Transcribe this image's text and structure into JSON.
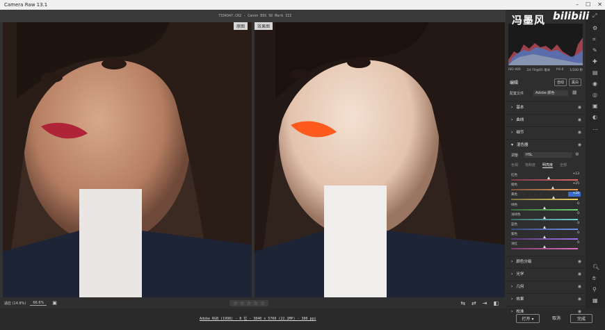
{
  "window": {
    "title": "Camera Raw 13.1"
  },
  "file": {
    "info": "7334347.CR2  -  Canon EOS 5D Mark III"
  },
  "watermark": {
    "text": "冯墨风",
    "logo": "bilibili"
  },
  "preview": {
    "before_label": "原图",
    "after_label": "效果图"
  },
  "viewbar": {
    "fit_label": "适应 (14.8%)",
    "zoom_value": "66.6%",
    "stars": "☆ ☆ ☆ ☆ ☆"
  },
  "status": {
    "image_info": "Adobe RGB (1998) - 8 位 - 3840 x 5760 (22.1MP) - 300 ppi"
  },
  "buttons": {
    "open": "打开",
    "cancel": "取消",
    "done": "完成"
  },
  "panel": {
    "meta": {
      "iso": "ISO 400",
      "lens": "24-70@85 毫米",
      "aperture": "f/4.0",
      "shutter": "1/200 秒"
    },
    "edit_title": "编辑",
    "auto_label": "自动",
    "bw_label": "黑白",
    "profile_label": "配置文件",
    "profile_value": "Adobe 颜色",
    "sections_top": [
      "基本",
      "曲线",
      "细节",
      "混色器"
    ],
    "hsl_adjust_label": "调整",
    "hsl_mode": "HSL",
    "hsl_tabs": [
      "色相",
      "饱和度",
      "明亮度",
      "全部"
    ],
    "hsl_active_tab": "明亮度",
    "sliders": [
      {
        "label": "红色",
        "value": "+13",
        "level": 0.56
      },
      {
        "label": "橙色",
        "value": "+25",
        "level": 0.63
      },
      {
        "label": "黄色",
        "value": "+28",
        "level": 0.64
      },
      {
        "label": "绿色",
        "value": "0",
        "level": 0.5
      },
      {
        "label": "浅绿色",
        "value": "0",
        "level": 0.5
      },
      {
        "label": "蓝色",
        "value": "0",
        "level": 0.5
      },
      {
        "label": "紫色",
        "value": "0",
        "level": 0.5
      },
      {
        "label": "洋红",
        "value": "0",
        "level": 0.5
      }
    ],
    "sections_bottom": [
      "颜色分级",
      "光学",
      "几何",
      "效果",
      "校准"
    ]
  },
  "colors": {
    "accent": "#3b6cc9",
    "panel_bg": "#2e2e2e",
    "lips_before": "#b02438",
    "lips_after": "#ff5a1e"
  }
}
